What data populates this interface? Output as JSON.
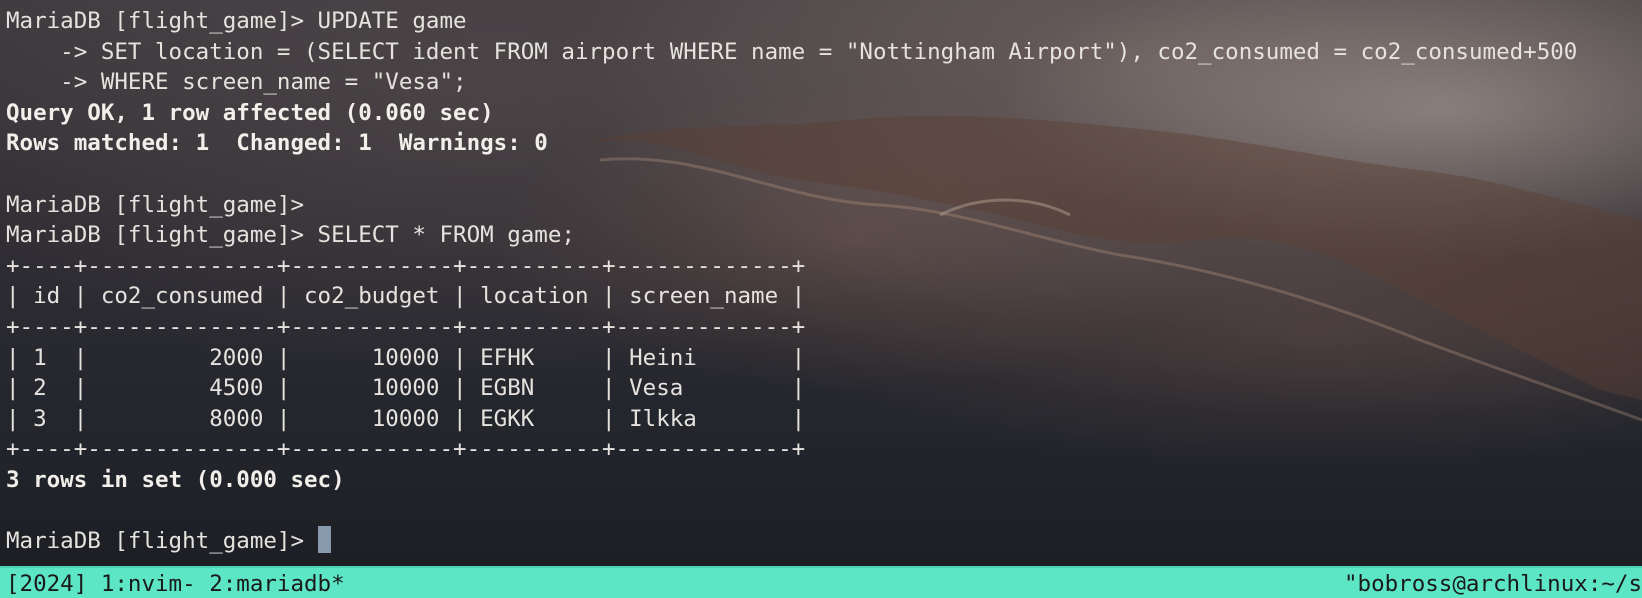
{
  "terminal": {
    "lines": [
      "MariaDB [flight_game]> UPDATE game",
      "    -> SET location = (SELECT ident FROM airport WHERE name = \"Nottingham Airport\"), co2_consumed = co2_consumed+500",
      "    -> WHERE screen_name = \"Vesa\";",
      "Query OK, 1 row affected (0.060 sec)",
      "Rows matched: 1  Changed: 1  Warnings: 0",
      "",
      "MariaDB [flight_game]>",
      "MariaDB [flight_game]> SELECT * FROM game;",
      "+----+--------------+------------+----------+-------------+",
      "| id | co2_consumed | co2_budget | location | screen_name |",
      "+----+--------------+------------+----------+-------------+",
      "| 1  |         2000 |      10000 | EFHK     | Heini       |",
      "| 2  |         4500 |      10000 | EGBN     | Vesa        |",
      "| 3  |         8000 |      10000 | EGKK     | Ilkka       |",
      "+----+--------------+------------+----------+-------------+",
      "3 rows in set (0.000 sec)",
      "",
      "MariaDB [flight_game]> "
    ]
  },
  "status_bar": {
    "left": "[2024] 1:nvim- 2:mariadb*",
    "right": "\"bobross@archlinux:~/s"
  },
  "colors": {
    "status_bar_bg": "#5de6c6",
    "text": "#e6e3df",
    "cursor": "#8a9aae"
  }
}
